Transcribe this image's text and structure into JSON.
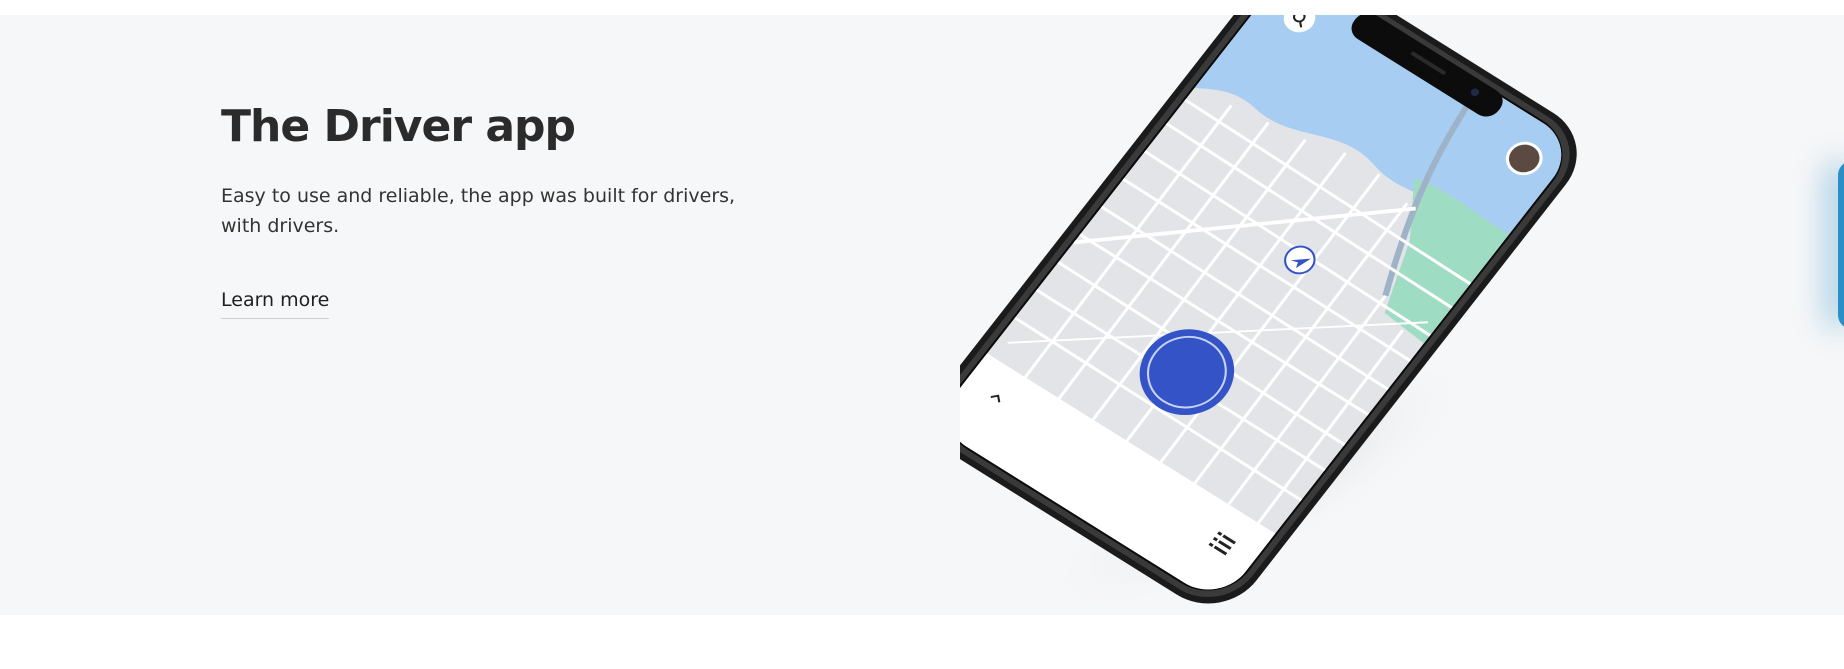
{
  "section": {
    "title": "The Driver app",
    "description": "Easy to use and reliable, the app was built for drivers, with drivers.",
    "learn_more_label": "Learn more"
  },
  "phone": {
    "image_alt": "Driver app map screen on a smartphone"
  },
  "colors": {
    "band_background": "#f6f7f8",
    "title_text": "#2b2b2b",
    "go_button": "#3353c7",
    "water": "#a8cdf2",
    "park": "#9fdcc4",
    "map_streets_bg": "#e3e4e7"
  }
}
